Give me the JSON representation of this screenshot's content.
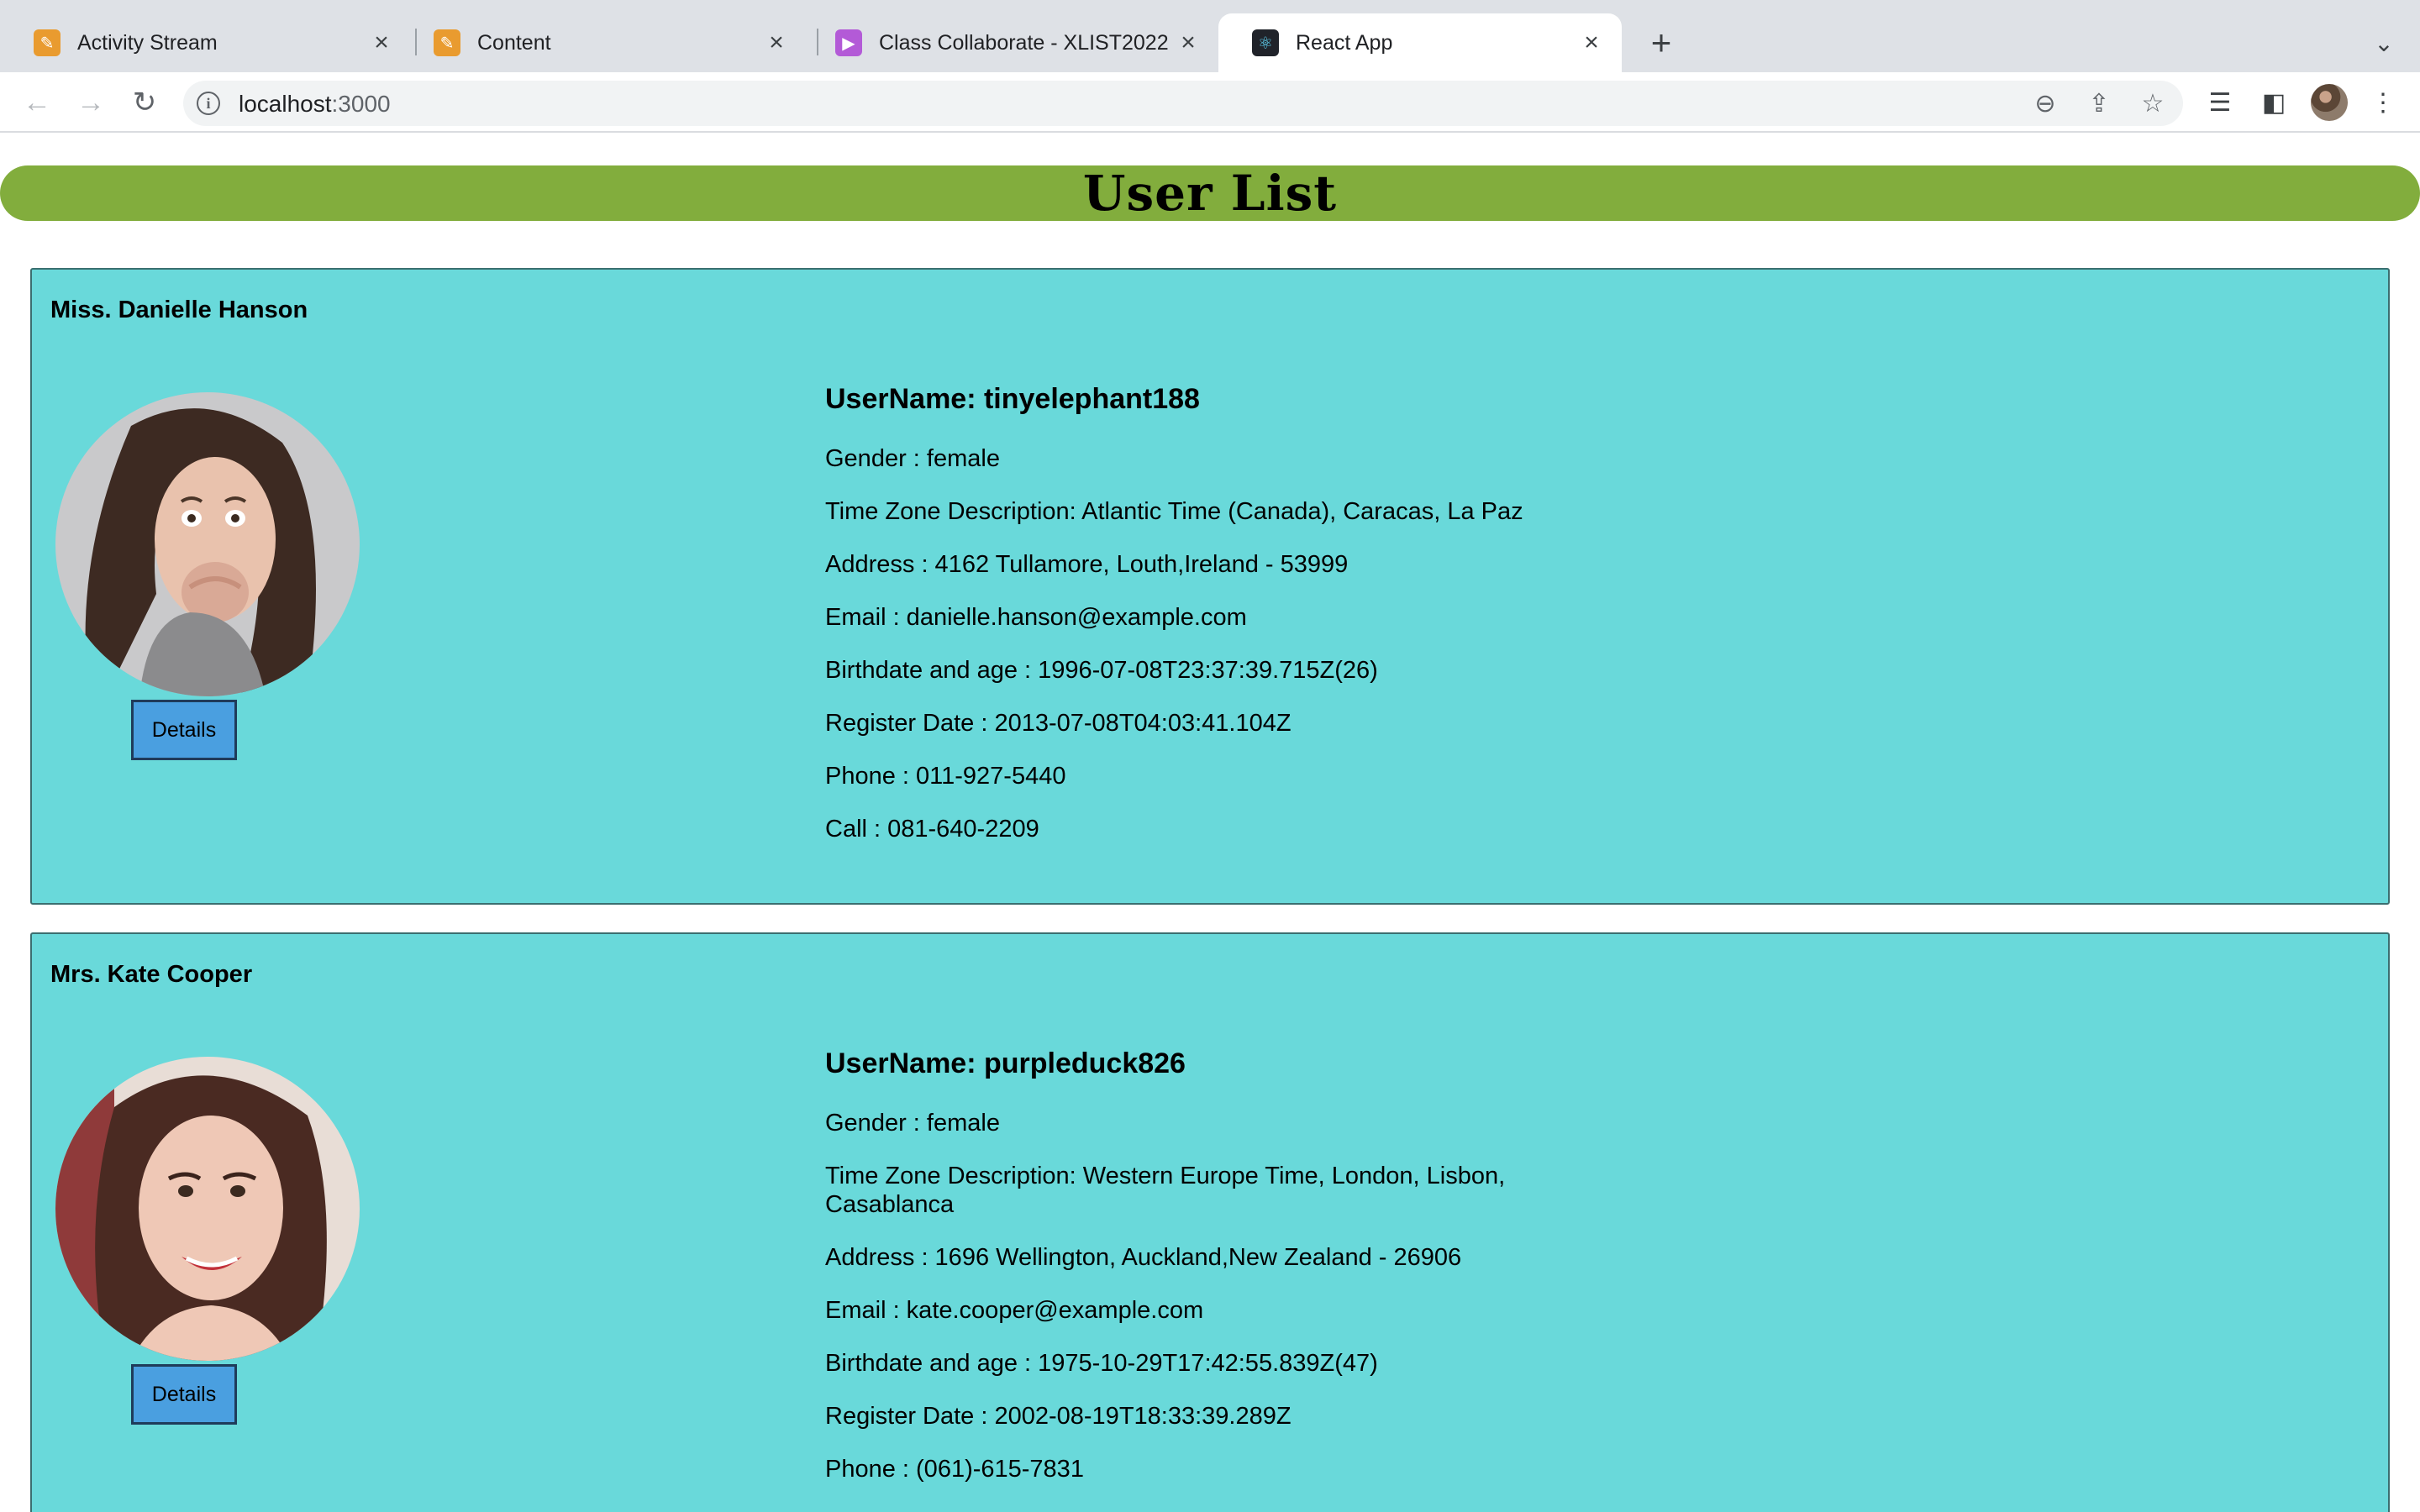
{
  "browser": {
    "tabs": [
      {
        "title": "Activity Stream",
        "icon": "pencil-note-icon",
        "color": "#e99b2f"
      },
      {
        "title": "Content",
        "icon": "pencil-note-icon",
        "color": "#e99b2f"
      },
      {
        "title": "Class Collaborate - XLIST2022",
        "icon": "collaborate-icon",
        "color": "#b35ad7"
      },
      {
        "title": "React App",
        "icon": "react-icon",
        "color": "#20232a"
      }
    ],
    "url_host": "localhost",
    "url_port": ":3000"
  },
  "page": {
    "title": "User List",
    "details_label": "Details",
    "users": [
      {
        "full_name": "Miss. Danielle Hanson",
        "username": "UserName: tinyelephant188",
        "gender": "Gender : female",
        "timezone": "Time Zone Description: Atlantic Time (Canada), Caracas, La Paz",
        "address": "Address : 4162 Tullamore, Louth,Ireland - 53999",
        "email": "Email : danielle.hanson@example.com",
        "birth": "Birthdate and age : 1996-07-08T23:37:39.715Z(26)",
        "registered": "Register Date : 2013-07-08T04:03:41.104Z",
        "phone": "Phone : 011-927-5440",
        "call": "Call : 081-640-2209"
      },
      {
        "full_name": "Mrs. Kate Cooper",
        "username": "UserName: purpleduck826",
        "gender": "Gender : female",
        "timezone": "Time Zone Description: Western Europe Time, London, Lisbon, Casablanca",
        "address": "Address : 1696 Wellington, Auckland,New Zealand - 26906",
        "email": "Email : kate.cooper@example.com",
        "birth": "Birthdate and age : 1975-10-29T17:42:55.839Z(47)",
        "registered": "Register Date : 2002-08-19T18:33:39.289Z",
        "phone": "Phone : (061)-615-7831",
        "call": ""
      }
    ]
  },
  "colors": {
    "banner": "#82ad3d",
    "card": "#69d9da",
    "button": "#4a9fe0"
  }
}
